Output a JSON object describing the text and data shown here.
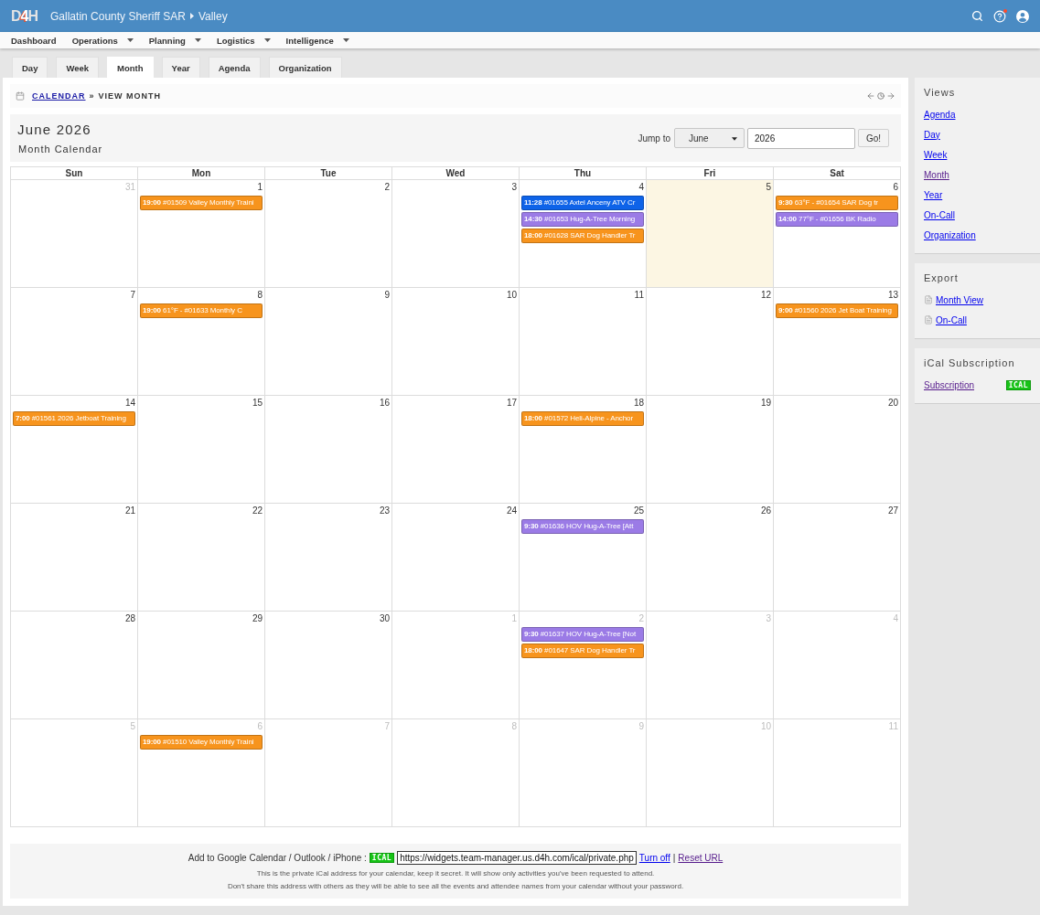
{
  "header": {
    "logo": "D4H",
    "organization": "Gallatin County Sheriff SAR",
    "unit": "Valley",
    "notification": true
  },
  "menu": [
    {
      "label": "Dashboard",
      "has_menu": false
    },
    {
      "label": "Operations",
      "has_menu": true
    },
    {
      "label": "Planning",
      "has_menu": true
    },
    {
      "label": "Logistics",
      "has_menu": true
    },
    {
      "label": "Intelligence",
      "has_menu": true
    }
  ],
  "tabs": [
    {
      "label": "Day",
      "selected": false
    },
    {
      "label": "Week",
      "selected": false
    },
    {
      "label": "Month",
      "selected": true
    },
    {
      "label": "Year",
      "selected": false
    },
    {
      "label": "Agenda",
      "selected": false
    },
    {
      "label": "Organization",
      "selected": false
    }
  ],
  "breadcrumb": {
    "link": "CALENDAR",
    "separator": "»",
    "current": "VIEW MONTH"
  },
  "title": {
    "heading": "June 2026",
    "subheading": "Month Calendar"
  },
  "jump": {
    "label": "Jump to",
    "month": "June",
    "year": "2026",
    "button": "Go!"
  },
  "calendar": {
    "weekdays": [
      "Sun",
      "Mon",
      "Tue",
      "Wed",
      "Thu",
      "Fri",
      "Sat"
    ],
    "weeks": [
      {
        "days": [
          {
            "number": "31",
            "other_month": true,
            "today": false
          },
          {
            "number": "1",
            "other_month": false,
            "today": false,
            "events": [
              {
                "time": "19:00",
                "title": "#01509 Valley Monthly Traini",
                "color": "#f7941d"
              }
            ]
          },
          {
            "number": "2",
            "other_month": false,
            "today": false
          },
          {
            "number": "3",
            "other_month": false,
            "today": false
          },
          {
            "number": "4",
            "other_month": false,
            "today": false,
            "events": [
              {
                "time": "11:28",
                "title": "#01655 Axtel Anceny ATV Cr",
                "color": "#0e63e8"
              },
              {
                "time": "14:30",
                "title": "#01653 Hug-A-Tree Morning",
                "color": "#9b7be6"
              },
              {
                "time": "18:00",
                "title": "#01628 SAR Dog Handler Tr",
                "color": "#f7941d"
              }
            ]
          },
          {
            "number": "5",
            "other_month": false,
            "today": true
          },
          {
            "number": "6",
            "other_month": false,
            "today": false,
            "events": [
              {
                "time": "9:30",
                "title": "63°F - #01654 SAR Dog tr",
                "color": "#f7941d"
              },
              {
                "time": "14:00",
                "title": "77°F - #01656 BK Radio",
                "color": "#9b7be6"
              }
            ]
          }
        ]
      },
      {
        "days": [
          {
            "number": "7",
            "other_month": false,
            "today": false
          },
          {
            "number": "8",
            "other_month": false,
            "today": false,
            "events": [
              {
                "time": "19:00",
                "title": "61°F - #01633 Monthly C",
                "color": "#f7941d"
              }
            ]
          },
          {
            "number": "9",
            "other_month": false,
            "today": false
          },
          {
            "number": "10",
            "other_month": false,
            "today": false
          },
          {
            "number": "11",
            "other_month": false,
            "today": false
          },
          {
            "number": "12",
            "other_month": false,
            "today": false
          },
          {
            "number": "13",
            "other_month": false,
            "today": false,
            "events": [
              {
                "time": "9:00",
                "title": "#01560 2026 Jet Boat Training",
                "color": "#f7941d"
              }
            ]
          }
        ]
      },
      {
        "days": [
          {
            "number": "14",
            "other_month": false,
            "today": false,
            "events": [
              {
                "time": "7:00",
                "title": "#01561 2026 Jetboat Training",
                "color": "#f7941d"
              }
            ]
          },
          {
            "number": "15",
            "other_month": false,
            "today": false
          },
          {
            "number": "16",
            "other_month": false,
            "today": false
          },
          {
            "number": "17",
            "other_month": false,
            "today": false
          },
          {
            "number": "18",
            "other_month": false,
            "today": false,
            "events": [
              {
                "time": "18:00",
                "title": "#01572 Heli-Alpine - Anchor",
                "color": "#f7941d"
              }
            ]
          },
          {
            "number": "19",
            "other_month": false,
            "today": false
          },
          {
            "number": "20",
            "other_month": false,
            "today": false
          }
        ]
      },
      {
        "days": [
          {
            "number": "21",
            "other_month": false,
            "today": false
          },
          {
            "number": "22",
            "other_month": false,
            "today": false
          },
          {
            "number": "23",
            "other_month": false,
            "today": false
          },
          {
            "number": "24",
            "other_month": false,
            "today": false
          },
          {
            "number": "25",
            "other_month": false,
            "today": false,
            "events": [
              {
                "time": "9:30",
                "title": "#01636 HOV Hug-A-Tree [Att",
                "color": "#9b7be6"
              }
            ]
          },
          {
            "number": "26",
            "other_month": false,
            "today": false
          },
          {
            "number": "27",
            "other_month": false,
            "today": false
          }
        ]
      },
      {
        "days": [
          {
            "number": "28",
            "other_month": false,
            "today": false
          },
          {
            "number": "29",
            "other_month": false,
            "today": false
          },
          {
            "number": "30",
            "other_month": false,
            "today": false
          },
          {
            "number": "1",
            "other_month": true,
            "today": false
          },
          {
            "number": "2",
            "other_month": true,
            "today": false,
            "events": [
              {
                "time": "9:30",
                "title": "#01637 HOV Hug-A-Tree [Not",
                "color": "#9b7be6"
              },
              {
                "time": "18:00",
                "title": "#01647 SAR Dog Handler Tr",
                "color": "#f7941d"
              }
            ]
          },
          {
            "number": "3",
            "other_month": true,
            "today": false
          },
          {
            "number": "4",
            "other_month": true,
            "today": false
          }
        ]
      },
      {
        "days": [
          {
            "number": "5",
            "other_month": true,
            "today": false
          },
          {
            "number": "6",
            "other_month": true,
            "today": false,
            "events": [
              {
                "time": "19:00",
                "title": "#01510 Valley Monthly Traini",
                "color": "#f7941d"
              }
            ]
          },
          {
            "number": "7",
            "other_month": true,
            "today": false
          },
          {
            "number": "8",
            "other_month": true,
            "today": false
          },
          {
            "number": "9",
            "other_month": true,
            "today": false
          },
          {
            "number": "10",
            "other_month": true,
            "today": false
          },
          {
            "number": "11",
            "other_month": true,
            "today": false
          }
        ]
      }
    ]
  },
  "sidebar": [
    {
      "title": "Views",
      "links": [
        {
          "label": "Agenda",
          "visited": false,
          "kind": "plain"
        },
        {
          "label": "Day",
          "visited": false,
          "kind": "plain"
        },
        {
          "label": "Week",
          "visited": false,
          "kind": "plain"
        },
        {
          "label": "Month",
          "visited": true,
          "kind": "plain"
        },
        {
          "label": "Year",
          "visited": false,
          "kind": "plain"
        },
        {
          "label": "On-Call",
          "visited": false,
          "kind": "plain"
        },
        {
          "label": "Organization",
          "visited": false,
          "kind": "plain"
        }
      ]
    },
    {
      "title": "Export",
      "links": [
        {
          "label": "Month View",
          "visited": false,
          "kind": "file"
        },
        {
          "label": "On-Call",
          "visited": false,
          "kind": "file"
        }
      ]
    },
    {
      "title": "iCal Subscription",
      "links": [
        {
          "label": "Subscription",
          "visited": true,
          "kind": "badge",
          "badge": "ICAL"
        }
      ]
    }
  ],
  "footer": {
    "label": "Add to Google Calendar / Outlook / iPhone :",
    "badge": "ICAL",
    "url": "https://widgets.team-manager.us.d4h.com/ical/private.php",
    "links": [
      {
        "label": "Turn off",
        "visited": false
      },
      {
        "label": "Reset URL",
        "visited": true
      }
    ],
    "separator": "|",
    "notes": [
      "This is the private iCal address for your calendar, keep it secret. It will show only activities you've been requested to attend.",
      "Don't share this address with others as they will be able to see all the events and attendee names from your calendar without your password."
    ]
  }
}
